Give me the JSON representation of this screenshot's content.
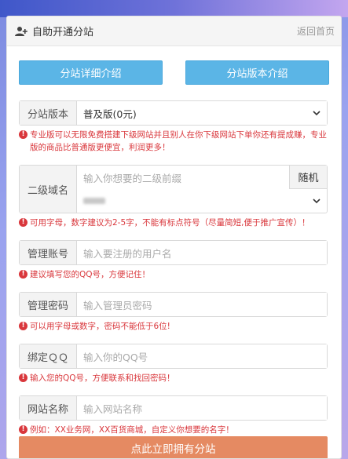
{
  "header": {
    "title": "自助开通分站",
    "back_link": "返回首页"
  },
  "buttons": {
    "detail": "分站详细介绍",
    "version": "分站版本介绍",
    "submit": "点此立即拥有分站"
  },
  "form": {
    "version": {
      "label": "分站版本",
      "selected": "普及版(0元)",
      "hint": "专业版可以无限免费搭建下级网站并且别人在你下级网站下单你还有提成赚，专业版的商品比普通版更便宜，利润更多！"
    },
    "domain": {
      "label": "二级域名",
      "placeholder": "输入你想要的二级前缀",
      "random_button": "随机",
      "hint": "可用字母，数字建议为2-5字，不能有标点符号（尽量简短,便于推广宣传）！"
    },
    "account": {
      "label": "管理账号",
      "placeholder": "输入要注册的用户名",
      "hint": "建议填写您的QQ号，方便记住！"
    },
    "password": {
      "label": "管理密码",
      "placeholder": "输入管理员密码",
      "hint": "可以用字母或数字，密码不能低于6位!"
    },
    "qq": {
      "label": "绑定ＱＱ",
      "placeholder": "输入你的QQ号",
      "hint": "输入您的QQ号，方便联系和找回密码！"
    },
    "site_name": {
      "label": "网站名称",
      "placeholder": "输入网站名称",
      "hint": "例如：XX业务网，XX百货商城，自定义你想要的名字！"
    }
  },
  "colors": {
    "info_button": "#5bb5e6",
    "submit_button": "#e58a62",
    "hint_text": "#d9373c"
  }
}
